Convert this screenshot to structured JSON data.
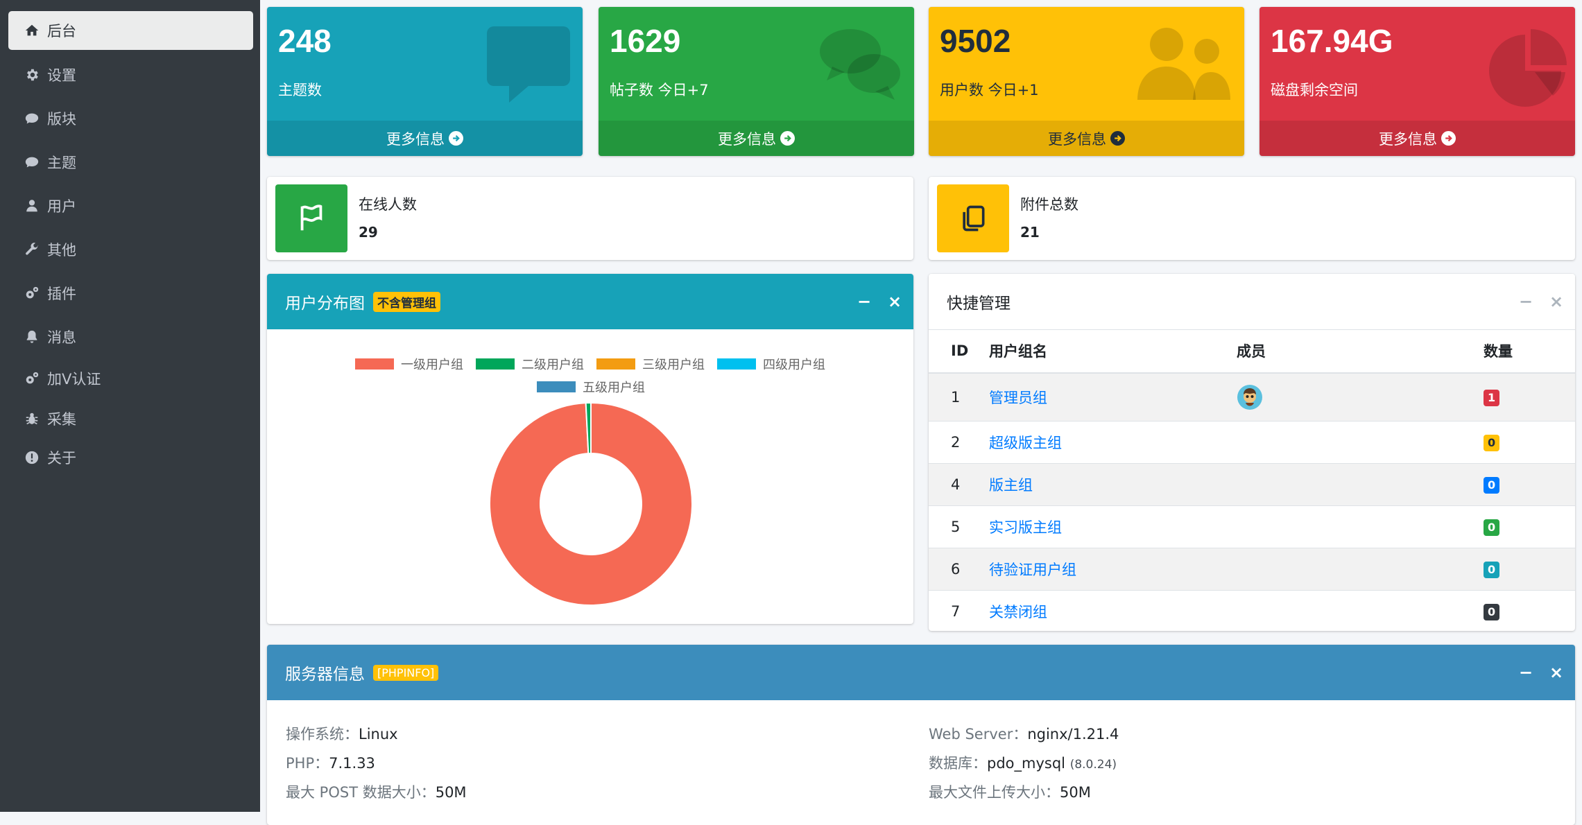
{
  "sidebar": {
    "items": [
      {
        "label": "后台",
        "icon": "home-icon"
      },
      {
        "label": "设置",
        "icon": "gear-icon"
      },
      {
        "label": "版块",
        "icon": "comment-icon"
      },
      {
        "label": "主题",
        "icon": "comment-icon"
      },
      {
        "label": "用户",
        "icon": "user-icon"
      },
      {
        "label": "其他",
        "icon": "wrench-icon"
      },
      {
        "label": "插件",
        "icon": "gears-icon"
      },
      {
        "label": "消息",
        "icon": "bell-icon"
      },
      {
        "label": "加V认证",
        "icon": "gears-icon"
      },
      {
        "label": "采集",
        "icon": "bug-icon"
      },
      {
        "label": "关于",
        "icon": "exclamation-circle-icon"
      }
    ]
  },
  "stats": [
    {
      "value": "248",
      "label": "主题数",
      "more": "更多信息",
      "color": "#17a2b8",
      "icon": "speech-bubble-icon"
    },
    {
      "value": "1629",
      "label": "帖子数 今日+7",
      "more": "更多信息",
      "color": "#28a745",
      "icon": "comments-icon"
    },
    {
      "value": "9502",
      "label": "用户数 今日+1",
      "more": "更多信息",
      "color": "#ffc107",
      "icon": "users-icon"
    },
    {
      "value": "167.94G",
      "label": "磁盘剩余空间",
      "more": "更多信息",
      "color": "#dc3545",
      "icon": "pie-chart-icon"
    }
  ],
  "info": [
    {
      "label": "在线人数",
      "value": "29",
      "color": "#28a745",
      "icon": "flag-icon"
    },
    {
      "label": "附件总数",
      "value": "21",
      "color": "#ffc107",
      "icon": "copy-icon"
    }
  ],
  "user_chart": {
    "title": "用户分布图",
    "badge": "不含管理组",
    "header_color": "#17a2b8"
  },
  "chart_data": {
    "type": "pie",
    "donut": true,
    "categories": [
      "一级用户组",
      "二级用户组",
      "三级用户组",
      "四级用户组",
      "五级用户组"
    ],
    "values": [
      99.2,
      0.8,
      0,
      0,
      0
    ],
    "colors": [
      "#f56954",
      "#00a65a",
      "#f39c12",
      "#00c0ef",
      "#3c8dbc"
    ],
    "legend": "top"
  },
  "quick": {
    "title": "快捷管理",
    "headers": [
      "ID",
      "用户组名",
      "成员",
      "数量"
    ],
    "rows": [
      {
        "id": "1",
        "name": "管理员组",
        "avatar": true,
        "count": "1",
        "color": "#dc3545",
        "text": "#ffffff"
      },
      {
        "id": "2",
        "name": "超级版主组",
        "avatar": false,
        "count": "0",
        "color": "#ffc107",
        "text": "#1f2d3d"
      },
      {
        "id": "4",
        "name": "版主组",
        "avatar": false,
        "count": "0",
        "color": "#007bff",
        "text": "#ffffff"
      },
      {
        "id": "5",
        "name": "实习版主组",
        "avatar": false,
        "count": "0",
        "color": "#28a745",
        "text": "#ffffff"
      },
      {
        "id": "6",
        "name": "待验证用户组",
        "avatar": false,
        "count": "0",
        "color": "#17a2b8",
        "text": "#ffffff"
      },
      {
        "id": "7",
        "name": "关禁闭组",
        "avatar": false,
        "count": "0",
        "color": "#343a40",
        "text": "#ffffff"
      }
    ]
  },
  "server": {
    "title": "服务器信息",
    "badge": "[PHPINFO]",
    "header_color": "#3c8dbc",
    "left": [
      {
        "label": "操作系统：",
        "value": "Linux",
        "small": ""
      },
      {
        "label": "PHP：",
        "value": "7.1.33",
        "small": ""
      },
      {
        "label": "最大 POST 数据大小：",
        "value": "50M",
        "small": ""
      }
    ],
    "right": [
      {
        "label": "Web Server：",
        "value": "nginx/1.21.4",
        "small": ""
      },
      {
        "label": "数据库：",
        "value": "pdo_mysql",
        "small": "(8.0.24)"
      },
      {
        "label": "最大文件上传大小：",
        "value": "50M",
        "small": ""
      }
    ]
  },
  "tools": {
    "minimize": "−",
    "close": "×"
  }
}
